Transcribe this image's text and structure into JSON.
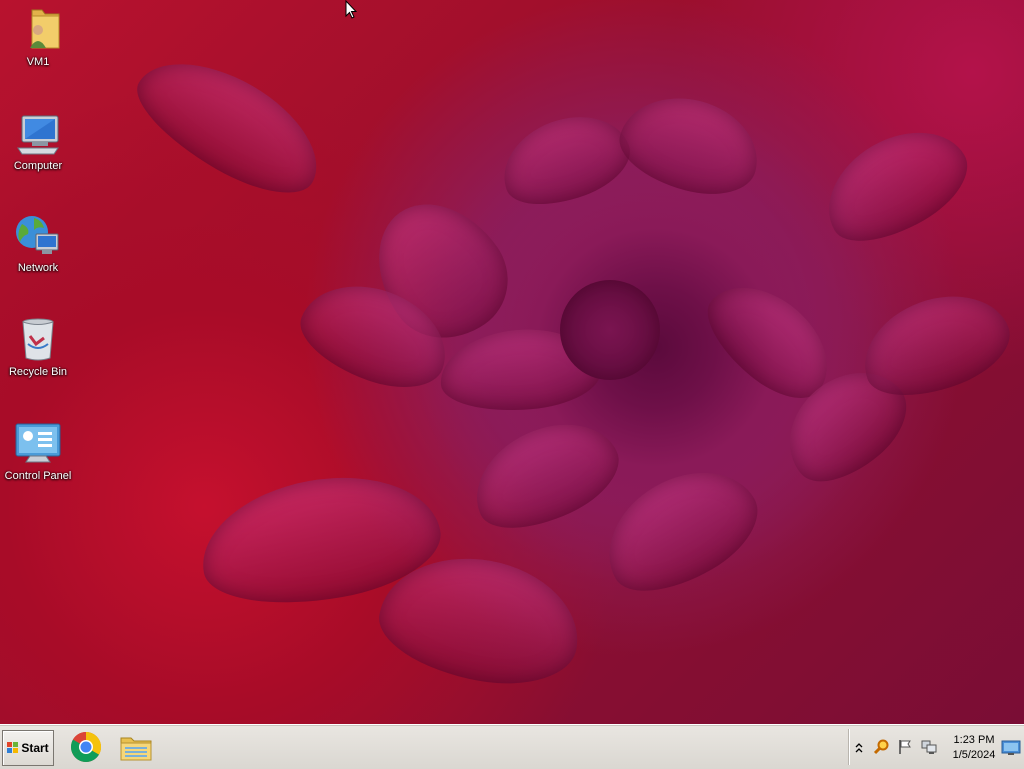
{
  "desktop": {
    "icons": [
      {
        "label": "VM1",
        "icon": "user-folder-icon"
      },
      {
        "label": "Computer",
        "icon": "computer-icon"
      },
      {
        "label": "Network",
        "icon": "network-icon"
      },
      {
        "label": "Recycle Bin",
        "icon": "recycle-bin-icon"
      },
      {
        "label": "Control Panel",
        "icon": "control-panel-icon"
      }
    ]
  },
  "taskbar": {
    "start_label": "Start",
    "pinned": [
      {
        "icon": "chrome-icon"
      },
      {
        "icon": "file-explorer-icon"
      }
    ],
    "tray": {
      "icons": [
        "show-hidden-icons-chevron",
        "search-magnifier-icon",
        "action-center-flag-icon",
        "network-status-icon"
      ],
      "time": "1:23 PM",
      "date": "1/5/2024"
    }
  },
  "colors": {
    "wallpaper_primary": "#b8122e",
    "wallpaper_flower": "#8e1d5a",
    "taskbar": "#dad7d1"
  }
}
